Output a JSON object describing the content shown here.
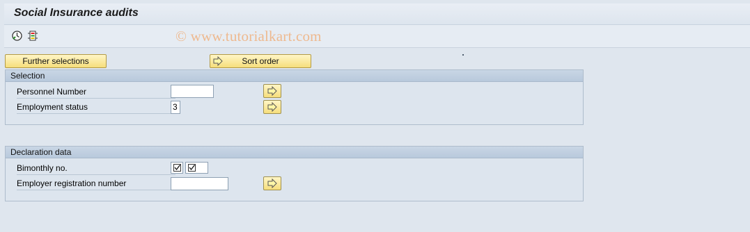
{
  "header": {
    "title": "Social Insurance audits"
  },
  "toolbar": {
    "icons": [
      "execute-icon",
      "selection-options-icon"
    ],
    "watermark": "© www.tutorialkart.com"
  },
  "buttons": {
    "further_selections": "Further selections",
    "sort_order": "Sort order"
  },
  "selection": {
    "title": "Selection",
    "personnel_number": {
      "label": "Personnel Number",
      "value": ""
    },
    "employment_status": {
      "label": "Employment status",
      "value": "3"
    }
  },
  "declaration": {
    "title": "Declaration data",
    "bimonthly_no": {
      "label": "Bimonthly no.",
      "checked": [
        true,
        true
      ]
    },
    "employer_registration": {
      "label": "Employer registration number",
      "value": ""
    }
  },
  "colors": {
    "button_yellow": "#f6de7c",
    "frame_header": "#b8c9dc",
    "background": "#dfe6ee",
    "watermark": "#eeb98f"
  }
}
